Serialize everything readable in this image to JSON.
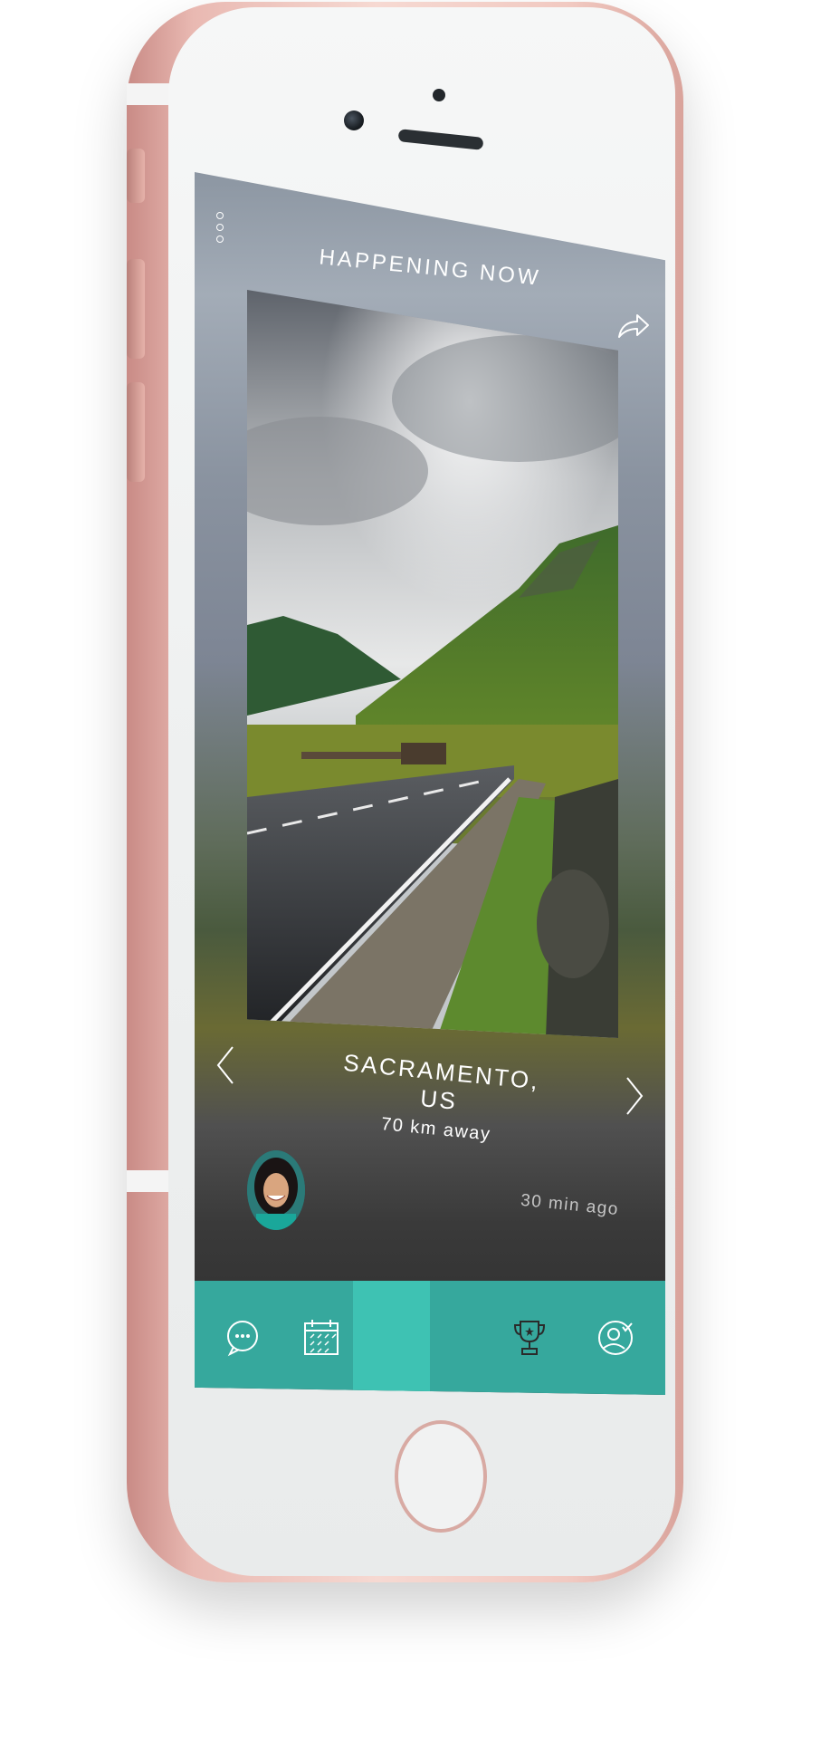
{
  "screen": {
    "header": {
      "title": "HAPPENING NOW"
    },
    "icons": {
      "menu": "vertical-dots-icon",
      "share": "share-arrow-icon",
      "prev": "chevron-left-icon",
      "next": "chevron-right-icon"
    },
    "event": {
      "location": "SACRAMENTO, US",
      "distance": "70 km away",
      "time_ago": "30 min ago"
    },
    "tabbar": {
      "tabs": [
        {
          "icon": "chat-icon",
          "active": false
        },
        {
          "icon": "calendar-icon",
          "active": false
        },
        {
          "icon": "blank-tab",
          "active": true
        },
        {
          "icon": "trophy-icon",
          "active": false
        },
        {
          "icon": "profile-check-icon",
          "active": false
        }
      ]
    }
  },
  "colors": {
    "accent": "#36a89d",
    "accent_active": "#3ec2b3",
    "phone_rose_gold": "#e9b9b2",
    "text": "#ffffff"
  }
}
